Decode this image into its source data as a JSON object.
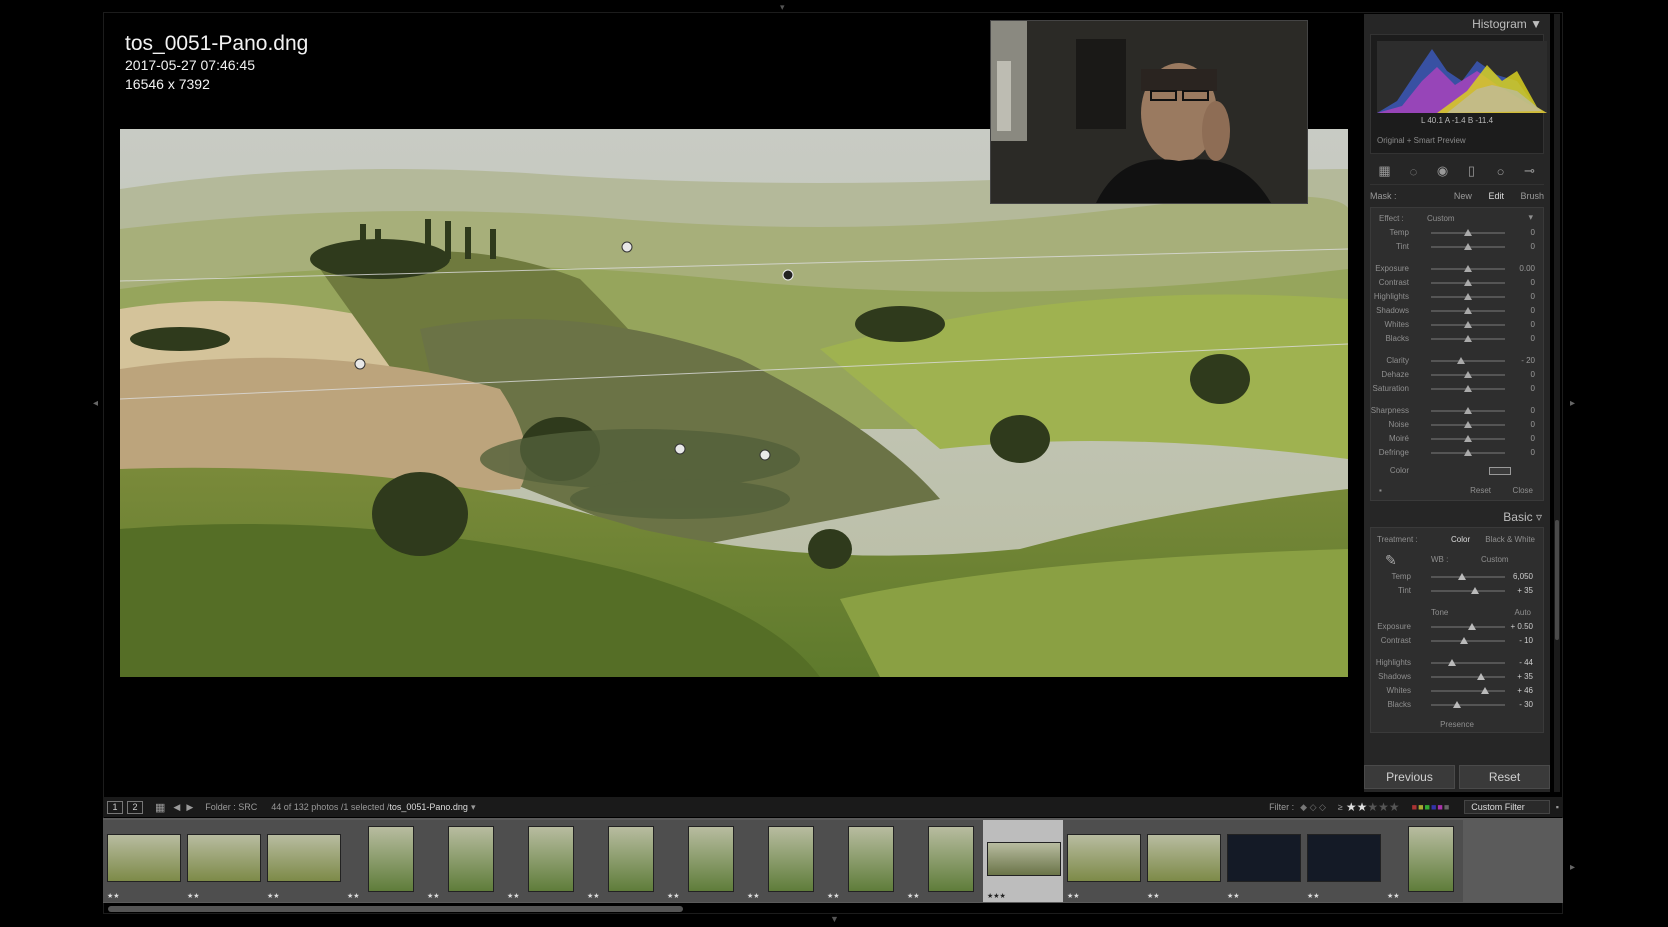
{
  "file": {
    "name": "tos_0051-Pano.dng",
    "datetime": "2017-05-27 07:46:45",
    "dimensions": "16546 x 7392"
  },
  "histogram": {
    "title": "Histogram",
    "readout": "L  40.1   A   -1.4   B  -11.4",
    "preview": "Original + Smart Preview"
  },
  "mask": {
    "label": "Mask :",
    "options": [
      "New",
      "Edit",
      "Brush"
    ]
  },
  "effect": {
    "label": "Effect :",
    "preset": "Custom",
    "sliders": [
      {
        "label": "Temp",
        "value": "0",
        "pos": 0.5
      },
      {
        "label": "Tint",
        "value": "0",
        "pos": 0.5
      },
      {
        "label": "Exposure",
        "value": "0.00",
        "pos": 0.5
      },
      {
        "label": "Contrast",
        "value": "0",
        "pos": 0.5
      },
      {
        "label": "Highlights",
        "value": "0",
        "pos": 0.5
      },
      {
        "label": "Shadows",
        "value": "0",
        "pos": 0.5
      },
      {
        "label": "Whites",
        "value": "0",
        "pos": 0.5
      },
      {
        "label": "Blacks",
        "value": "0",
        "pos": 0.5
      },
      {
        "label": "Clarity",
        "value": "- 20",
        "pos": 0.4
      },
      {
        "label": "Dehaze",
        "value": "0",
        "pos": 0.5
      },
      {
        "label": "Saturation",
        "value": "0",
        "pos": 0.5
      },
      {
        "label": "Sharpness",
        "value": "0",
        "pos": 0.5
      },
      {
        "label": "Noise",
        "value": "0",
        "pos": 0.5
      },
      {
        "label": "Moiré",
        "value": "0",
        "pos": 0.5
      },
      {
        "label": "Defringe",
        "value": "0",
        "pos": 0.5
      }
    ],
    "color_label": "Color",
    "reset": "Reset",
    "close": "Close"
  },
  "basic": {
    "title": "Basic",
    "treatment_label": "Treatment :",
    "treatment_options": [
      "Color",
      "Black & White"
    ],
    "wb_label": "WB :",
    "wb_value": "Custom",
    "wb_sliders": [
      {
        "label": "Temp",
        "value": "6,050",
        "pos": 0.42
      },
      {
        "label": "Tint",
        "value": "+ 35",
        "pos": 0.6
      }
    ],
    "tone_label": "Tone",
    "auto_label": "Auto",
    "tone_sliders": [
      {
        "label": "Exposure",
        "value": "+ 0.50",
        "pos": 0.55
      },
      {
        "label": "Contrast",
        "value": "- 10",
        "pos": 0.45
      }
    ],
    "tone_sliders2": [
      {
        "label": "Highlights",
        "value": "- 44",
        "pos": 0.28
      },
      {
        "label": "Shadows",
        "value": "+ 35",
        "pos": 0.67
      },
      {
        "label": "Whites",
        "value": "+ 46",
        "pos": 0.73
      },
      {
        "label": "Blacks",
        "value": "- 30",
        "pos": 0.35
      }
    ],
    "presence_label": "Presence"
  },
  "buttons": {
    "previous": "Previous",
    "reset": "Reset"
  },
  "filmstrip_bar": {
    "screen1": "1",
    "screen2": "2",
    "folder": "Folder : SRC",
    "count": "44 of 132 photos /1 selected /",
    "selected_file": "tos_0051-Pano.dng",
    "filter_label": "Filter :",
    "rating_op": "≥",
    "custom_filter": "Custom Filter"
  },
  "filmstrip": [
    {
      "stars": "★★",
      "kind": "wide"
    },
    {
      "stars": "★★",
      "kind": "wide"
    },
    {
      "stars": "★★",
      "kind": "wide"
    },
    {
      "stars": "★★",
      "kind": "tall"
    },
    {
      "stars": "★★",
      "kind": "tall"
    },
    {
      "stars": "★★",
      "kind": "tall"
    },
    {
      "stars": "★★",
      "kind": "tall"
    },
    {
      "stars": "★★",
      "kind": "tall"
    },
    {
      "stars": "★★",
      "kind": "tall"
    },
    {
      "stars": "★★",
      "kind": "tall"
    },
    {
      "stars": "★★",
      "kind": "tall"
    },
    {
      "stars": "★★★",
      "kind": "selected"
    },
    {
      "stars": "★★",
      "kind": "wide"
    },
    {
      "stars": "★★",
      "kind": "wide"
    },
    {
      "stars": "★★",
      "kind": "night"
    },
    {
      "stars": "★★",
      "kind": "night"
    },
    {
      "stars": "★★",
      "kind": "tall"
    }
  ],
  "colors": {
    "panel_bg": "#262626",
    "accent_magenta": "#c040c0",
    "hist_yellow": "#d8d020"
  }
}
